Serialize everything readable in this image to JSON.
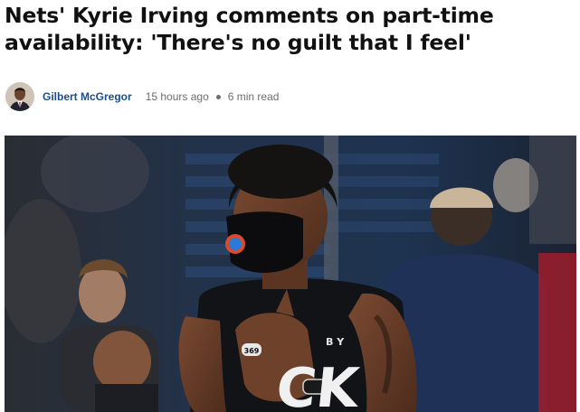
{
  "article": {
    "headline_line1": "Nets' Kyrie Irving comments on part-time",
    "headline_line2": "availability: 'There's no guilt that I feel'",
    "author": "Gilbert McGregor",
    "time_ago": "15 hours ago",
    "read_time": "6 min read"
  },
  "photo": {
    "jersey_text_top": "B Y",
    "jersey_letters": "CK",
    "ring_text": "369"
  }
}
